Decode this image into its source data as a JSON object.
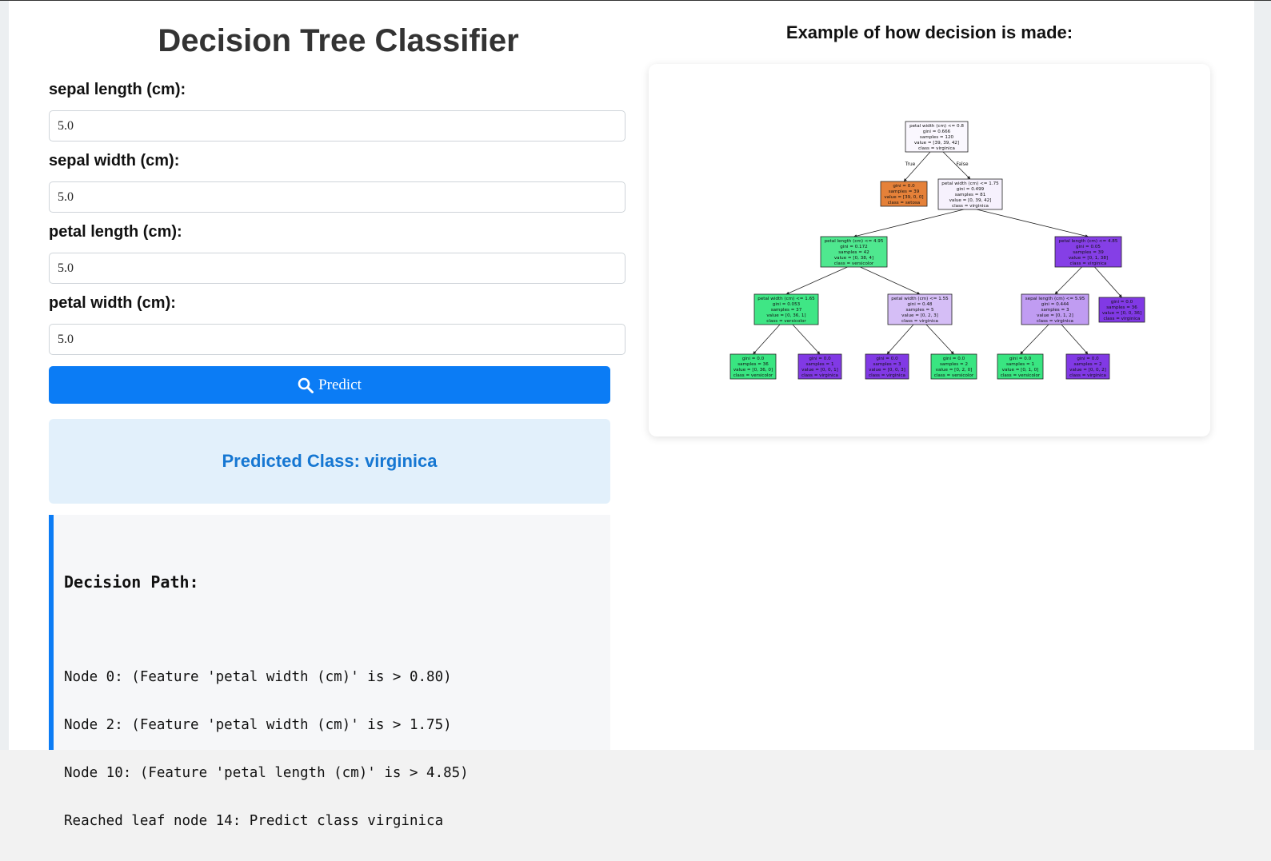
{
  "header": {
    "title": "Decision Tree Classifier"
  },
  "form": {
    "fields": [
      {
        "label": "sepal length (cm):",
        "value": "5.0"
      },
      {
        "label": "sepal width (cm):",
        "value": "5.0"
      },
      {
        "label": "petal length (cm):",
        "value": "5.0"
      },
      {
        "label": "petal width (cm):",
        "value": "5.0"
      }
    ],
    "predict_label": "Predict",
    "predict_icon": "search-icon"
  },
  "result": {
    "text": "Predicted Class: virginica"
  },
  "decision_path": {
    "title": "Decision Path:",
    "lines": [
      "Node 0: (Feature 'petal width (cm)' is > 0.80)",
      "Node 2: (Feature 'petal width (cm)' is > 1.75)",
      "Node 10: (Feature 'petal length (cm)' is > 4.85)",
      "Reached leaf node 14: Predict class virginica"
    ]
  },
  "example": {
    "title": "Example of how decision is made:",
    "edge_labels": {
      "true": "True",
      "false": "False"
    },
    "class_colors": {
      "setosa": "#e58139",
      "versicolor": "#39e581",
      "virginica": "#8139e5"
    },
    "nodes": [
      {
        "id": 0,
        "lines": [
          "petal width (cm) <= 0.8",
          "gini = 0.666",
          "samples = 120",
          "value = [39, 39, 42]",
          "class = virginica"
        ],
        "cls": "virginica",
        "purity": 0.04
      },
      {
        "id": 1,
        "lines": [
          "gini = 0.0",
          "samples = 39",
          "value = [39, 0, 0]",
          "class = setosa"
        ],
        "cls": "setosa",
        "purity": 1.0
      },
      {
        "id": 2,
        "lines": [
          "petal width (cm) <= 1.75",
          "gini = 0.499",
          "samples = 81",
          "value = [0, 39, 42]",
          "class = virginica"
        ],
        "cls": "virginica",
        "purity": 0.07
      },
      {
        "id": 3,
        "lines": [
          "petal length (cm) <= 4.95",
          "gini = 0.172",
          "samples = 42",
          "value = [0, 38, 4]",
          "class = versicolor"
        ],
        "cls": "versicolor",
        "purity": 0.89
      },
      {
        "id": 4,
        "lines": [
          "petal length (cm) <= 4.85",
          "gini = 0.05",
          "samples = 39",
          "value = [0, 1, 38]",
          "class = virginica"
        ],
        "cls": "virginica",
        "purity": 0.97
      },
      {
        "id": 5,
        "lines": [
          "petal width (cm) <= 1.65",
          "gini = 0.053",
          "samples = 37",
          "value = [0, 36, 1]",
          "class = versicolor"
        ],
        "cls": "versicolor",
        "purity": 0.97
      },
      {
        "id": 6,
        "lines": [
          "petal width (cm) <= 1.55",
          "gini = 0.48",
          "samples = 5",
          "value = [0, 2, 3]",
          "class = virginica"
        ],
        "cls": "virginica",
        "purity": 0.33
      },
      {
        "id": 7,
        "lines": [
          "sepal length (cm) <= 5.95",
          "gini = 0.444",
          "samples = 3",
          "value = [0, 1, 2]",
          "class = virginica"
        ],
        "cls": "virginica",
        "purity": 0.5
      },
      {
        "id": 8,
        "lines": [
          "gini = 0.0",
          "samples = 36",
          "value = [0, 0, 36]",
          "class = virginica"
        ],
        "cls": "virginica",
        "purity": 1.0
      },
      {
        "id": 9,
        "lines": [
          "gini = 0.0",
          "samples = 36",
          "value = [0, 36, 0]",
          "class = versicolor"
        ],
        "cls": "versicolor",
        "purity": 1.0
      },
      {
        "id": 10,
        "lines": [
          "gini = 0.0",
          "samples = 1",
          "value = [0, 0, 1]",
          "class = virginica"
        ],
        "cls": "virginica",
        "purity": 1.0
      },
      {
        "id": 11,
        "lines": [
          "gini = 0.0",
          "samples = 3",
          "value = [0, 0, 3]",
          "class = virginica"
        ],
        "cls": "virginica",
        "purity": 1.0
      },
      {
        "id": 12,
        "lines": [
          "gini = 0.0",
          "samples = 2",
          "value = [0, 2, 0]",
          "class = versicolor"
        ],
        "cls": "versicolor",
        "purity": 1.0
      },
      {
        "id": 13,
        "lines": [
          "gini = 0.0",
          "samples = 1",
          "value = [0, 1, 0]",
          "class = versicolor"
        ],
        "cls": "versicolor",
        "purity": 1.0
      },
      {
        "id": 14,
        "lines": [
          "gini = 0.0",
          "samples = 2",
          "value = [0, 0, 2]",
          "class = virginica"
        ],
        "cls": "virginica",
        "purity": 1.0
      }
    ],
    "edges": [
      [
        0,
        1
      ],
      [
        0,
        2
      ],
      [
        2,
        3
      ],
      [
        2,
        4
      ],
      [
        3,
        5
      ],
      [
        3,
        6
      ],
      [
        4,
        7
      ],
      [
        4,
        8
      ],
      [
        5,
        9
      ],
      [
        5,
        10
      ],
      [
        6,
        11
      ],
      [
        6,
        12
      ],
      [
        7,
        13
      ],
      [
        7,
        14
      ]
    ]
  }
}
